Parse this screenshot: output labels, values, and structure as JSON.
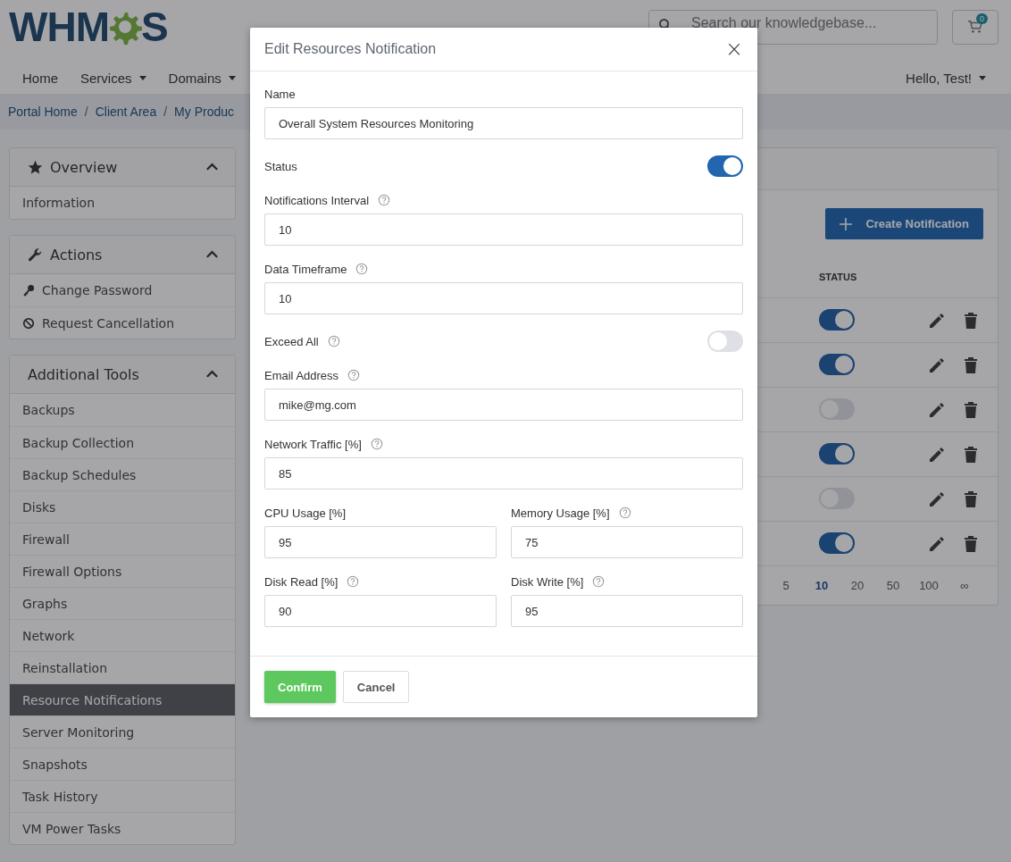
{
  "header": {
    "logo_left": "WHM",
    "logo_right": "S",
    "search": {
      "placeholder": "Search our knowledgebase..."
    },
    "cart_count": "0"
  },
  "nav": {
    "items": [
      {
        "label": "Home",
        "dropdown": false
      },
      {
        "label": "Services",
        "dropdown": true
      },
      {
        "label": "Domains",
        "dropdown": true
      }
    ],
    "user": {
      "label": "Hello, Test!",
      "dropdown": true
    }
  },
  "breadcrumb": {
    "items": [
      "Portal Home",
      "Client Area",
      "My Produc"
    ],
    "separators": [
      "/",
      "/"
    ]
  },
  "sidebar": {
    "panels": [
      {
        "title": "Overview",
        "items": [
          {
            "label": "Information",
            "selected": false
          }
        ]
      },
      {
        "title": "Actions",
        "items": [
          {
            "label": "Change Password",
            "selected": false
          },
          {
            "label": "Request Cancellation",
            "selected": false
          }
        ]
      },
      {
        "title": "Additional Tools",
        "items": [
          {
            "label": "Backups",
            "selected": false
          },
          {
            "label": "Backup Collection",
            "selected": false
          },
          {
            "label": "Backup Schedules",
            "selected": false
          },
          {
            "label": "Disks",
            "selected": false
          },
          {
            "label": "Firewall",
            "selected": false
          },
          {
            "label": "Firewall Options",
            "selected": false
          },
          {
            "label": "Graphs",
            "selected": false
          },
          {
            "label": "Network",
            "selected": false
          },
          {
            "label": "Reinstallation",
            "selected": false
          },
          {
            "label": "Resource Notifications",
            "selected": true
          },
          {
            "label": "Server Monitoring",
            "selected": false
          },
          {
            "label": "Snapshots",
            "selected": false
          },
          {
            "label": "Task History",
            "selected": false
          },
          {
            "label": "VM Power Tasks",
            "selected": false
          }
        ]
      }
    ]
  },
  "content": {
    "create_button": "Create Notification",
    "table": {
      "status_header": "STATUS",
      "rows": [
        {
          "on": true
        },
        {
          "on": true
        },
        {
          "on": false
        },
        {
          "on": true
        },
        {
          "on": false
        },
        {
          "on": true
        }
      ]
    },
    "page_sizes": [
      {
        "label": "5",
        "selected": false
      },
      {
        "label": "10",
        "selected": true
      },
      {
        "label": "20",
        "selected": false
      },
      {
        "label": "50",
        "selected": false
      },
      {
        "label": "100",
        "selected": false
      },
      {
        "label": "∞",
        "selected": false
      }
    ]
  },
  "modal": {
    "title": "Edit Resources Notification",
    "close": "×",
    "rows": [
      {
        "fields": [
          {
            "kind": "input",
            "label": "Name",
            "help": false,
            "value": "Overall System Resources Monitoring"
          }
        ]
      },
      {
        "fields": [
          {
            "kind": "toggle",
            "label": "Status",
            "help": false,
            "on": true
          }
        ]
      },
      {
        "fields": [
          {
            "kind": "input",
            "label": "Notifications Interval",
            "help": true,
            "value": "10"
          }
        ]
      },
      {
        "fields": [
          {
            "kind": "input",
            "label": "Data Timeframe",
            "help": true,
            "value": "10"
          }
        ]
      },
      {
        "fields": [
          {
            "kind": "toggle",
            "label": "Exceed All",
            "help": true,
            "on": false
          }
        ]
      },
      {
        "fields": [
          {
            "kind": "input",
            "label": "Email Address",
            "help": true,
            "value": "mike@mg.com"
          }
        ]
      },
      {
        "fields": [
          {
            "kind": "input",
            "label": "Network Traffic [%]",
            "help": true,
            "value": "85"
          }
        ]
      },
      {
        "fields": [
          {
            "kind": "input",
            "label": "CPU Usage [%]",
            "help": false,
            "value": "95"
          },
          {
            "kind": "input",
            "label": "Memory Usage [%]",
            "help": true,
            "value": "75"
          }
        ]
      },
      {
        "fields": [
          {
            "kind": "input",
            "label": "Disk Read [%]",
            "help": true,
            "value": "90"
          },
          {
            "kind": "input",
            "label": "Disk Write [%]",
            "help": true,
            "value": "95"
          }
        ]
      }
    ],
    "confirm": "Confirm",
    "cancel": "Cancel"
  }
}
